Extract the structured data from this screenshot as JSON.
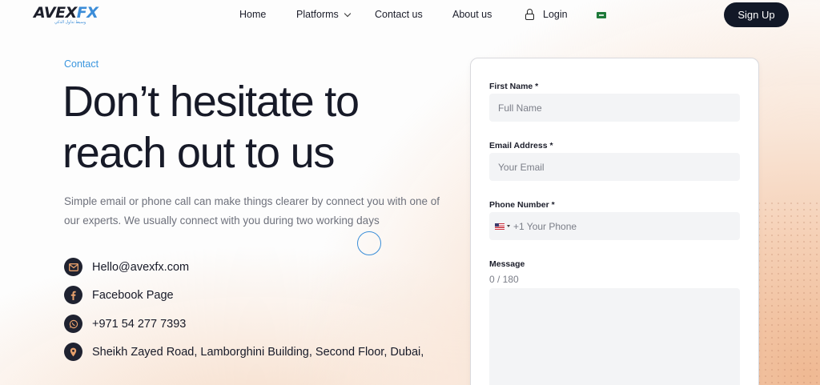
{
  "brand": {
    "name_main": "AVEX",
    "name_accent": "FX",
    "tagline": "وسيط تداول الذكي"
  },
  "nav": {
    "home": "Home",
    "platforms": "Platforms",
    "contact": "Contact us",
    "about": "About us",
    "login": "Login",
    "signup": "Sign Up"
  },
  "hero": {
    "eyebrow": "Contact",
    "headline": "Don’t hesitate to reach out to us",
    "description": "Simple email or phone call can make things clearer by connect you with one of our experts. We usually connect with you during two working days"
  },
  "contacts": {
    "email": "Hello@avexfx.com",
    "facebook": "Facebook Page",
    "phone": "+971 54 277 7393",
    "address": "Sheikh Zayed Road, Lamborghini Building, Second Floor, Dubai,"
  },
  "form": {
    "first_name_label": "First Name *",
    "first_name_placeholder": "Full Name",
    "email_label": "Email Address *",
    "email_placeholder": "Your Email",
    "phone_label": "Phone Number *",
    "phone_placeholder": "+1 Your Phone",
    "message_label": "Message",
    "message_counter": "0 / 180"
  },
  "colors": {
    "accent": "#3a96de",
    "button_dark": "#121827",
    "icon_accent": "#e7a06c"
  }
}
